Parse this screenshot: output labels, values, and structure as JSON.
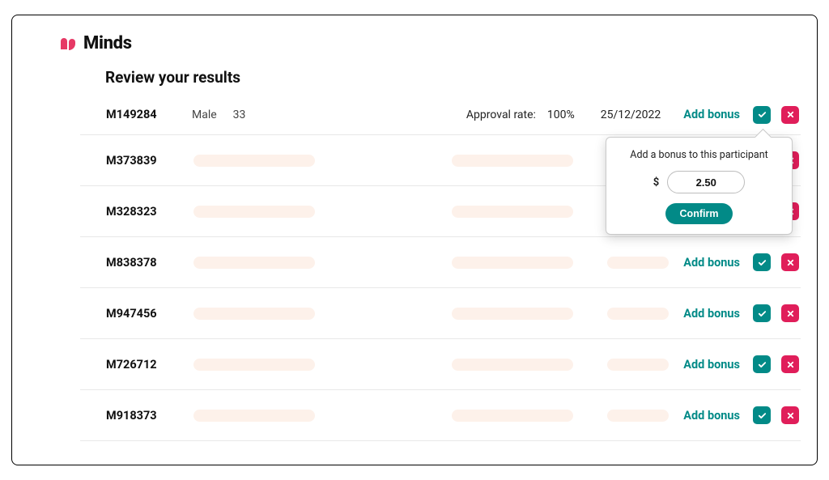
{
  "brand": {
    "name": "Minds"
  },
  "page": {
    "title": "Review your results"
  },
  "approval": {
    "label": "Approval rate:",
    "value": "100%",
    "date": "25/12/2022"
  },
  "labels": {
    "add_bonus": "Add bonus"
  },
  "popover": {
    "title": "Add a bonus to this participant",
    "currency": "$",
    "amount": "2.50",
    "confirm": "Confirm"
  },
  "participants": [
    {
      "id": "M149284",
      "gender": "Male",
      "age": "33"
    },
    {
      "id": "M373839"
    },
    {
      "id": "M328323"
    },
    {
      "id": "M838378"
    },
    {
      "id": "M947456"
    },
    {
      "id": "M726712"
    },
    {
      "id": "M918373"
    }
  ]
}
